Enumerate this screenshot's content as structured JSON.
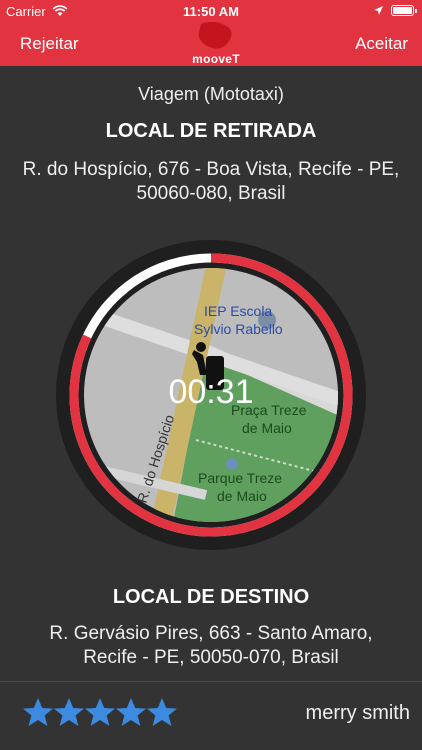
{
  "status_bar": {
    "carrier": "Carrier",
    "time": "11:50 AM"
  },
  "nav": {
    "reject_label": "Rejeitar",
    "accept_label": "Aceitar",
    "logo_text": "mooveT",
    "accent_color": "#e23340"
  },
  "trip": {
    "type": "Viagem  (Mototaxi)",
    "pickup_title": "LOCAL DE RETIRADA",
    "pickup_line1": "R. do Hospício,  676 - Boa Vista,  Recife - PE,",
    "pickup_line2": "50060-080,  Brasil",
    "destination_title": "LOCAL DE DESTINO",
    "destination_line1": "R. Gervásio Pires,  663 - Santo Amaro,",
    "destination_line2": "Recife - PE,  50050-070,  Brasil"
  },
  "timer": {
    "countdown": "00:31",
    "progress_fraction": 0.82
  },
  "map": {
    "labels": {
      "school": "IEP Escola",
      "school2": "Sylvio Rabello",
      "square": "Praça Treze",
      "square2": "de Maio",
      "park": "Parque Treze",
      "park2": "de Maio",
      "street": "R. do Hospício"
    },
    "pin_icon": "motorcycle-rider-icon"
  },
  "rider": {
    "name": "merry smith",
    "rating": 5,
    "star_color": "#3d8be0"
  }
}
